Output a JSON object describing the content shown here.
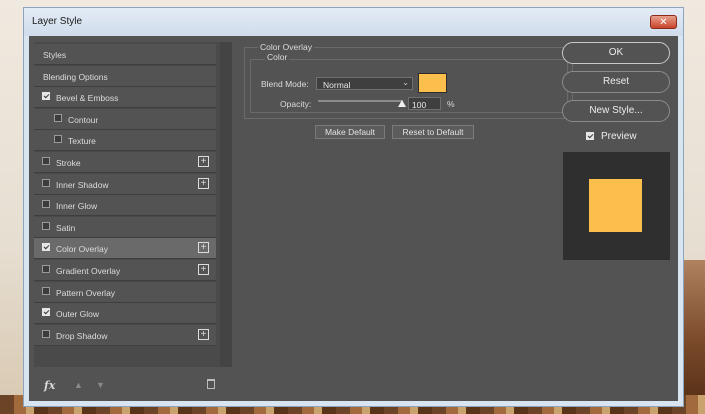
{
  "window": {
    "title": "Layer Style",
    "close_glyph": "✕"
  },
  "styles": [
    {
      "label": "Styles",
      "checkbox": false,
      "checked": false,
      "plus": false,
      "indent": false,
      "selected": false
    },
    {
      "label": "Blending Options",
      "checkbox": false,
      "checked": false,
      "plus": false,
      "indent": false,
      "selected": false
    },
    {
      "label": "Bevel & Emboss",
      "checkbox": true,
      "checked": true,
      "plus": false,
      "indent": false,
      "selected": false
    },
    {
      "label": "Contour",
      "checkbox": true,
      "checked": false,
      "plus": false,
      "indent": true,
      "selected": false
    },
    {
      "label": "Texture",
      "checkbox": true,
      "checked": false,
      "plus": false,
      "indent": true,
      "selected": false
    },
    {
      "label": "Stroke",
      "checkbox": true,
      "checked": false,
      "plus": true,
      "indent": false,
      "selected": false
    },
    {
      "label": "Inner Shadow",
      "checkbox": true,
      "checked": false,
      "plus": true,
      "indent": false,
      "selected": false
    },
    {
      "label": "Inner Glow",
      "checkbox": true,
      "checked": false,
      "plus": false,
      "indent": false,
      "selected": false
    },
    {
      "label": "Satin",
      "checkbox": true,
      "checked": false,
      "plus": false,
      "indent": false,
      "selected": false
    },
    {
      "label": "Color Overlay",
      "checkbox": true,
      "checked": true,
      "plus": true,
      "indent": false,
      "selected": true
    },
    {
      "label": "Gradient Overlay",
      "checkbox": true,
      "checked": false,
      "plus": true,
      "indent": false,
      "selected": false
    },
    {
      "label": "Pattern Overlay",
      "checkbox": true,
      "checked": false,
      "plus": false,
      "indent": false,
      "selected": false
    },
    {
      "label": "Outer Glow",
      "checkbox": true,
      "checked": true,
      "plus": false,
      "indent": false,
      "selected": false
    },
    {
      "label": "Drop Shadow",
      "checkbox": true,
      "checked": false,
      "plus": true,
      "indent": false,
      "selected": false
    }
  ],
  "footer": {
    "fx_label": "fx",
    "up_glyph": "▲",
    "down_glyph": "▼"
  },
  "color_overlay": {
    "group_title": "Color Overlay",
    "subgroup_title": "Color",
    "blend_mode_label": "Blend Mode:",
    "blend_mode_value": "Normal",
    "opacity_label": "Opacity:",
    "opacity_value": "100",
    "opacity_unit": "%",
    "opacity_fraction": 1.0,
    "color": "#fdbf4c",
    "make_default": "Make Default",
    "reset_to_default": "Reset to Default"
  },
  "actions": {
    "ok": "OK",
    "reset": "Reset",
    "new_style": "New Style...",
    "preview_label": "Preview",
    "preview_checked": true
  },
  "preview_color": "#fdbf4c"
}
